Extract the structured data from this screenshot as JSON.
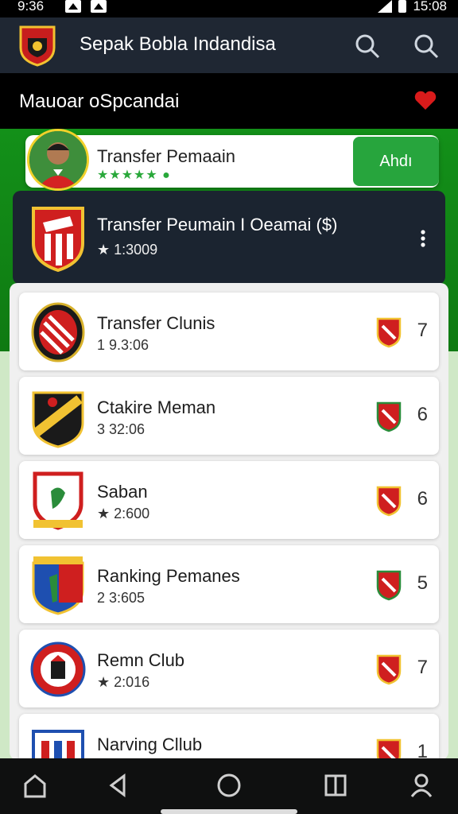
{
  "status": {
    "time": "9:36",
    "right_time": "15:08"
  },
  "appbar": {
    "title": "Sepak Bobla Indandisa"
  },
  "subheader": {
    "title": "Mauoar oSpcandai"
  },
  "featured": {
    "name": "Transfer Pemaain",
    "stars": "★★★★★ ●",
    "button": "Ahdı"
  },
  "dark_card": {
    "title": "Transfer Peumain I Oeamai ($)",
    "meta": "★ 1:3009"
  },
  "list": [
    {
      "title": "Transfer Clunis",
      "meta": "1 9.3:06",
      "number": "7"
    },
    {
      "title": "Ctakire Meman",
      "meta": "3 32:06",
      "number": "6"
    },
    {
      "title": "Saban",
      "meta": "★ 2:600",
      "number": "6"
    },
    {
      "title": "Ranking Pemanes",
      "meta": "2 3:605",
      "number": "5"
    },
    {
      "title": "Remn Club",
      "meta": "★ 2:016",
      "number": "7"
    },
    {
      "title": "Narving Cllub",
      "meta": "",
      "number": "1"
    }
  ],
  "icons": {
    "search": "search-icon",
    "favorite": "heart-icon",
    "menu": "kebab-menu-icon",
    "nav": [
      "home-icon",
      "back-icon",
      "recents-icon",
      "square-icon",
      "profile-icon"
    ]
  },
  "colors": {
    "appbar": "#1f2733",
    "green": "#139019",
    "accent": "#27a53d",
    "dark_card": "#1b2430"
  }
}
